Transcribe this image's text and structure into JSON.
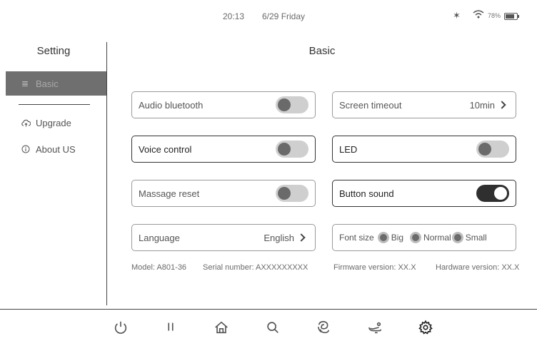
{
  "status_bar": {
    "time": "20:13",
    "date": "6/29 Friday",
    "battery_text": "78%",
    "battery_level": 0.78
  },
  "sidebar": {
    "title": "Setting",
    "items": [
      {
        "label": "Basic",
        "icon": "sliders-icon",
        "active": true
      },
      {
        "label": "Upgrade",
        "icon": "cloud-upload-icon",
        "active": false
      },
      {
        "label": "About US",
        "icon": "info-icon",
        "active": false
      }
    ]
  },
  "main": {
    "title": "Basic",
    "settings": {
      "audio_bluetooth": {
        "label": "Audio bluetooth",
        "enabled": false
      },
      "screen_timeout": {
        "label": "Screen timeout",
        "value": "10min"
      },
      "voice_control": {
        "label": "Voice control",
        "enabled": false
      },
      "led": {
        "label": "LED",
        "enabled": false
      },
      "massage_reset": {
        "label": "Massage reset",
        "enabled": false
      },
      "button_sound": {
        "label": "Button sound",
        "enabled": true
      },
      "language": {
        "label": "Language",
        "value": "English"
      },
      "font_size": {
        "label": "Font size",
        "options": [
          "Big",
          "Normal",
          "Small"
        ]
      }
    },
    "info": {
      "model": "Model: A801-36",
      "serial": "Serial number: AXXXXXXXXX",
      "firmware": "Firmware version: XX.X",
      "hardware": "Hardware version: XX.X"
    }
  },
  "bottom_nav": [
    {
      "icon": "power-icon"
    },
    {
      "icon": "pause-icon"
    },
    {
      "icon": "home-icon"
    },
    {
      "icon": "search-icon"
    },
    {
      "icon": "massage-hand-icon"
    },
    {
      "icon": "recline-icon"
    },
    {
      "icon": "gear-icon",
      "active": true
    }
  ],
  "colors": {
    "active_sidebar_bg": "#6f6f6f",
    "toggle_on": "#2f2f2f",
    "toggle_off": "#cfcfcf"
  }
}
